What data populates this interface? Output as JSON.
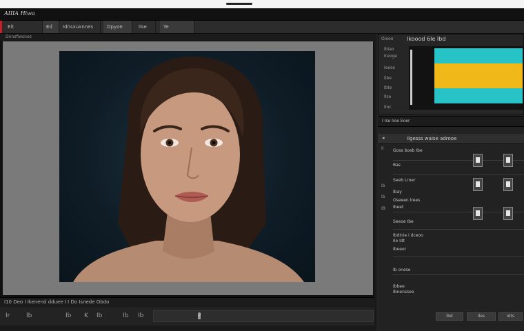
{
  "app": {
    "title": "AIIIA Hiwa"
  },
  "menubar": {
    "items": [
      "Eit",
      "Ed",
      "Idnsxuxnnes",
      "Opyoe",
      "Ilse",
      "Ye"
    ]
  },
  "canvas": {
    "header": "Dnnsfiwsnes"
  },
  "status": {
    "text": "I10 Deo I Ikenend dduee I I  Do Isnede Obdo"
  },
  "bottom_toolbar": {
    "tools": [
      "Ir",
      "Ib",
      "Ib",
      "K",
      "Ib",
      "Ib",
      "Ib"
    ],
    "scrub_value": "3"
  },
  "histogram": {
    "title": "Ikoood  6Ie Ibd",
    "side_labels": [
      "Oiooo",
      "Ibiao",
      "Ireoge",
      "Ieese",
      "Ilbe",
      "Ibte",
      "Ilse",
      "IIoc"
    ],
    "colors": {
      "cyan": "#28c3c6",
      "yellow": "#f0b818"
    }
  },
  "panel_bar": {
    "label": "I  Ise   Iioe Eoer"
  },
  "layers": {
    "header": "Ilgesss waise adrooe",
    "rows": [
      "Goss  boeb Ibe",
      "Bas",
      "Seeb  Lroer",
      "Ibay",
      "Oseeen lrees",
      "Ibeet",
      "Seeoe Ibe"
    ],
    "left_marks": [
      "Il",
      "Ib",
      "Ib",
      "IB"
    ]
  },
  "properties": {
    "sections": [
      "Ibdinie i dceoo",
      "IIe Idt",
      "Ibeeer",
      "Ib onese",
      "Ibbee",
      "Ibnenssee"
    ]
  },
  "right_buttons": [
    "Ibd",
    "Iles",
    "Idts"
  ]
}
